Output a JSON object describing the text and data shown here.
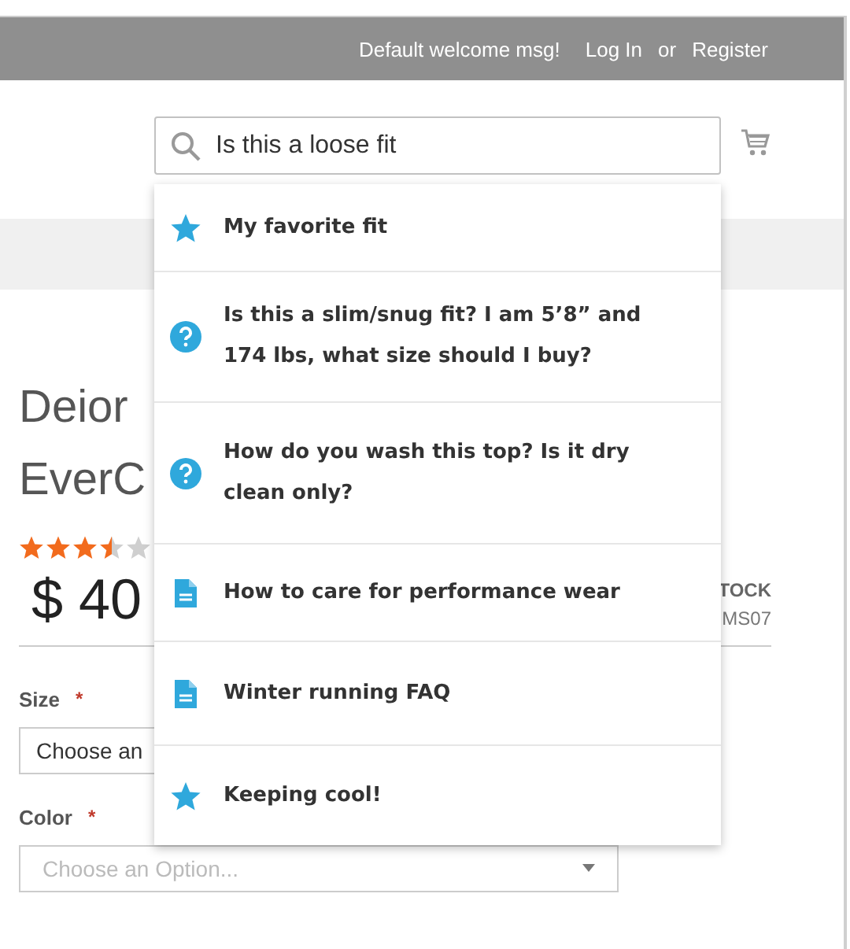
{
  "header": {
    "welcome": "Default welcome msg!",
    "login": "Log In",
    "or": "or",
    "register": "Register"
  },
  "search": {
    "value": "Is this a loose fit"
  },
  "suggestions": [
    {
      "kind": "favorite",
      "text": "My favorite fit"
    },
    {
      "kind": "question",
      "text": "Is this a slim/snug fit? I am 5’8” and 174 lbs, what size should I buy?"
    },
    {
      "kind": "question",
      "text": "How do you wash this top? Is it dry clean only?"
    },
    {
      "kind": "article",
      "text": "How to care for performance wear"
    },
    {
      "kind": "article",
      "text": "Winter running FAQ"
    },
    {
      "kind": "favorite",
      "text": "Keeping cool!"
    }
  ],
  "product": {
    "title_lines": [
      "Deior",
      "EverC"
    ],
    "stars": 3.5,
    "price": "$ 40",
    "stock": "TOCK",
    "sku": "MS07"
  },
  "options": [
    {
      "label": "Size",
      "required_mark": "*",
      "value": "Choose an"
    },
    {
      "label": "Color",
      "required_mark": "*",
      "placeholder": "Choose an Option..."
    }
  ]
}
